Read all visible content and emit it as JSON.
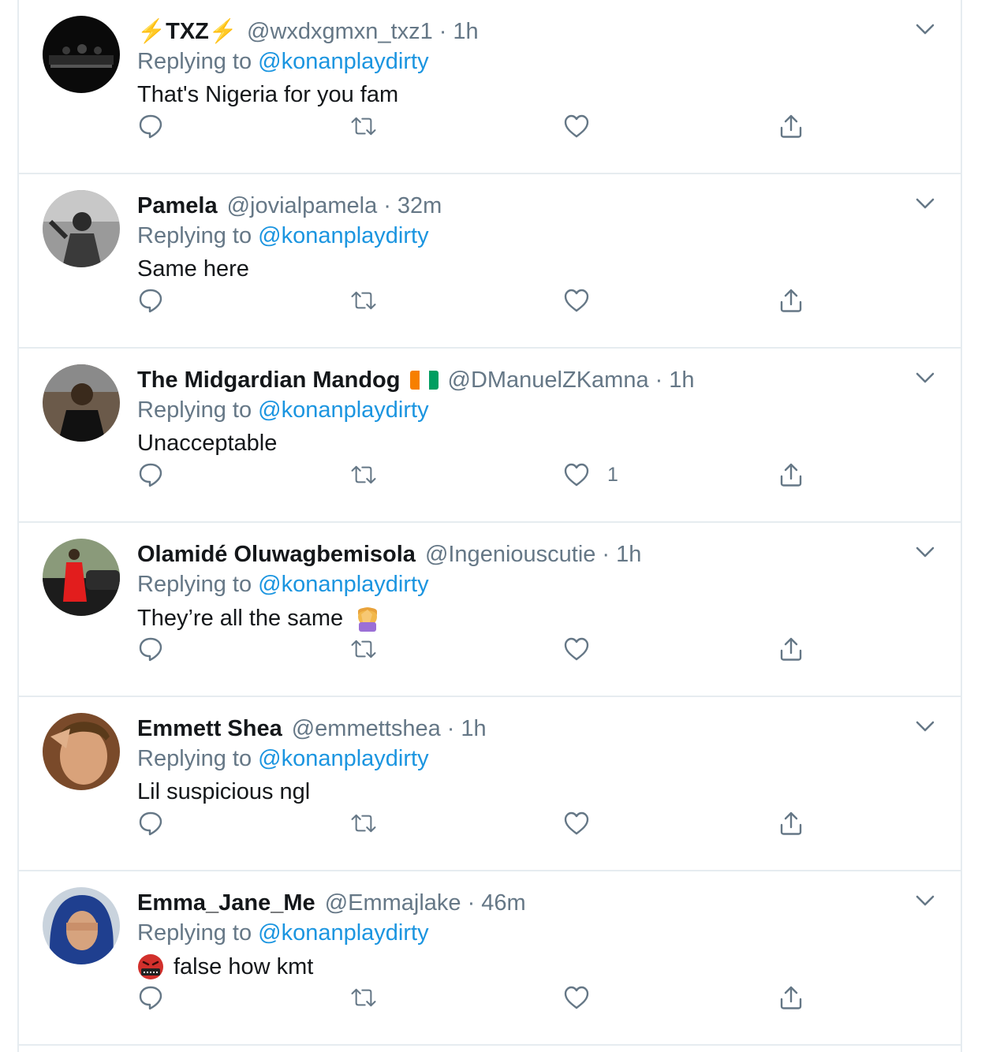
{
  "reply_prefix": "Replying to",
  "colors": {
    "link": "#1b95e0",
    "muted": "#657786",
    "text": "#14171a",
    "divider": "#e6ecf0"
  },
  "tweets": [
    {
      "name_prefix": "⚡",
      "name": "TXZ",
      "name_suffix": "⚡",
      "handle": "@wxdxgmxn_txz1",
      "sep": "·",
      "time": "1h",
      "mention": "@konanplaydirty",
      "text": "That's Nigeria for you fam",
      "likes": ""
    },
    {
      "name": "Pamela",
      "handle": "@jovialpamela",
      "sep": "·",
      "time": "32m",
      "mention": "@konanplaydirty",
      "text": "Same here",
      "likes": ""
    },
    {
      "name": "The Midgardian Mandog",
      "flag": "cote-divoire-flag",
      "handle": "@DManuelZKamna",
      "sep": "·",
      "time": "1h",
      "mention": "@konanplaydirty",
      "text": "Unacceptable",
      "likes": "1"
    },
    {
      "name": "Olamidé Oluwagbemisola",
      "handle": "@Ingeniouscutie",
      "sep": "·",
      "time": "1h",
      "mention": "@konanplaydirty",
      "text": "They’re all the same",
      "text_emoji": "facepalm-emoji",
      "likes": ""
    },
    {
      "name": "Emmett Shea",
      "handle": "@emmettshea",
      "sep": "·",
      "time": "1h",
      "mention": "@konanplaydirty",
      "text": "Lil suspicious ngl",
      "likes": ""
    },
    {
      "name": "Emma_Jane_Me",
      "handle": "@Emmajlake",
      "sep": "·",
      "time": "46m",
      "mention": "@konanplaydirty",
      "text": "false how kmt",
      "text_emoji_prefix": "cursing-face-emoji",
      "likes": ""
    }
  ]
}
